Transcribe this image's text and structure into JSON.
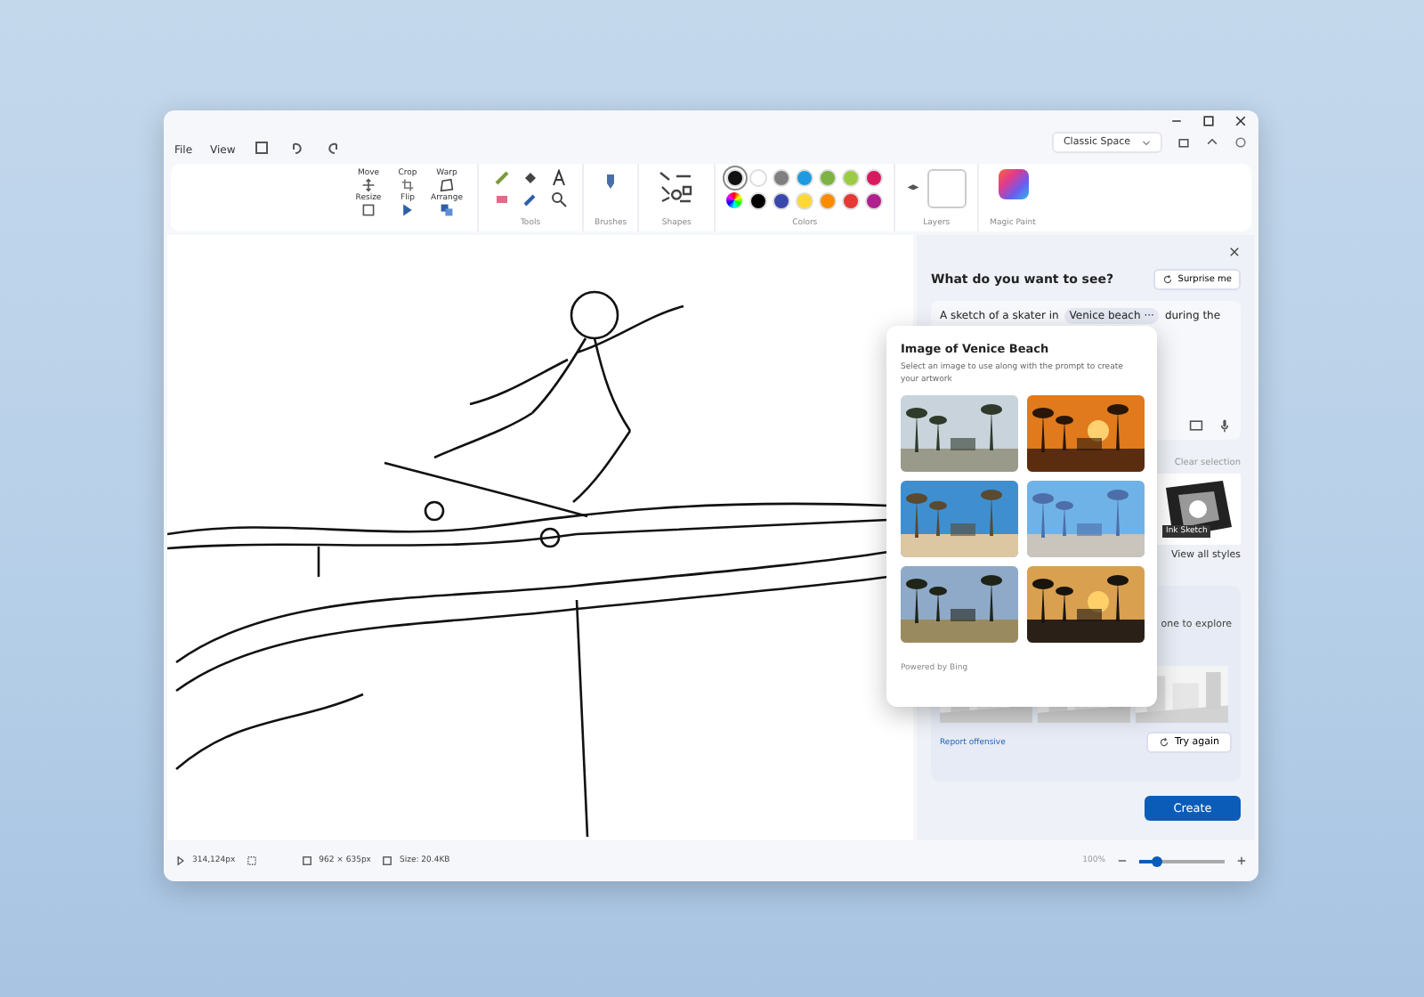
{
  "menu": [
    "File",
    "View"
  ],
  "layout_mode": "Classic Space",
  "ribbon": {
    "image_tools": [
      {
        "label": "Move",
        "kind": "move"
      },
      {
        "label": "Crop",
        "kind": "crop"
      },
      {
        "label": "Warp",
        "kind": "warp"
      },
      {
        "label": "Resize",
        "kind": "resize"
      },
      {
        "label": "Flip",
        "kind": "flip"
      },
      {
        "label": "Arrange",
        "kind": "arrange"
      }
    ],
    "tools_label": "Tools",
    "brushes_label": "Brushes",
    "shapes_label": "Shapes",
    "colors": {
      "label": "Colors",
      "swatches": [
        {
          "color": "#111111",
          "selected": true
        },
        {
          "color": "#ffffff",
          "selected": false
        },
        {
          "color": "#7f7f7f",
          "selected": false
        },
        {
          "color": "#1e9be0",
          "selected": false
        },
        {
          "color": "#7cb342",
          "selected": false
        },
        {
          "color": "#9ccc44",
          "selected": false
        },
        {
          "color": "#d81b60",
          "selected": false
        },
        {
          "color": "#000000",
          "selected": false
        },
        {
          "color": "#3949ab",
          "selected": false
        },
        {
          "color": "#fdd835",
          "selected": false
        },
        {
          "color": "#fb8c00",
          "selected": false
        },
        {
          "color": "#e53935",
          "selected": false
        },
        {
          "color": "#b0208e",
          "selected": false
        }
      ]
    },
    "layers_label": "Layers",
    "magic_paint_label": "Magic Paint"
  },
  "cocreator": {
    "heading": "What do you want to see?",
    "surprise_button": "Surprise me",
    "prompt_start": "A sketch of a skater in",
    "tag": "Venice beach",
    "tag_more": "···",
    "prompt_end": "during the",
    "clear_selection": "Clear selection",
    "style_label": "Ink Sketch",
    "view_all": "View all styles",
    "explore_text": "one to explore",
    "report": "Report offensive",
    "try_again": "Try again",
    "create": "Create"
  },
  "image_picker": {
    "title": "Image of Venice Beach",
    "description": "Select an image to use along with the prompt to create your artwork",
    "footer": "Powered by Bing"
  },
  "status_bar": {
    "cursor": "314,124px",
    "canvas_size": "962 × 635px",
    "file_size": "Size: 20.4KB",
    "zoom": "100%",
    "zoom_slider": {
      "level": 0.2
    }
  }
}
